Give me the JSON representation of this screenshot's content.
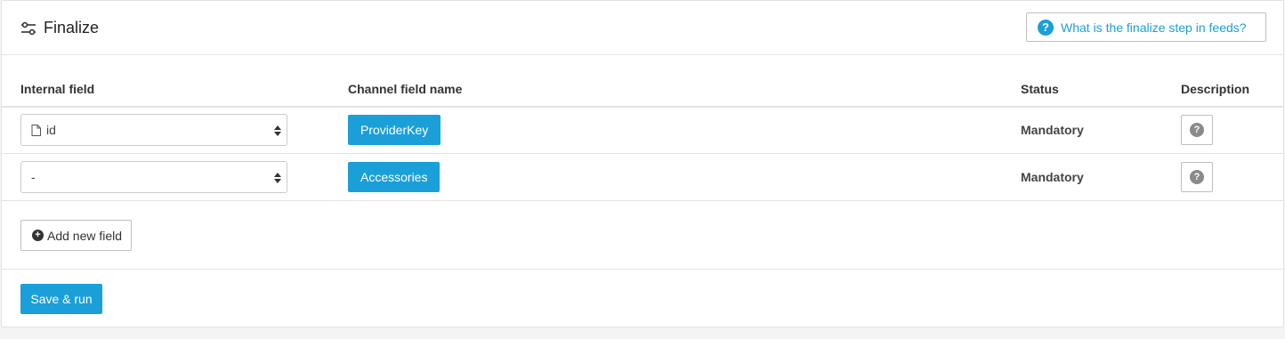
{
  "header": {
    "title": "Finalize",
    "title_icon": "sliders-icon",
    "help_link_label": "What is the finalize step in feeds?",
    "help_icon": "question-circle-icon"
  },
  "table": {
    "columns": [
      "Internal field",
      "Channel field name",
      "Status",
      "Description"
    ],
    "rows": [
      {
        "internal_field": "id",
        "internal_field_icon": "file-icon",
        "channel_field": "ProviderKey",
        "status": "Mandatory",
        "description_icon": "question-icon"
      },
      {
        "internal_field": "-",
        "channel_field": "Accessories",
        "status": "Mandatory",
        "description_icon": "question-icon"
      }
    ]
  },
  "actions": {
    "add_field_label": "Add new field",
    "add_field_icon": "plus-circle-icon",
    "save_label": "Save & run"
  },
  "colors": {
    "accent": "#1a9fd9",
    "border": "#bfbfbf"
  }
}
